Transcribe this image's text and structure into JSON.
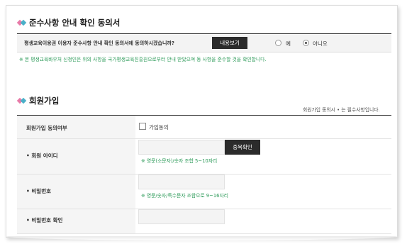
{
  "agreement": {
    "title": "준수사항 안내 확인 동의서",
    "question": "평생교육이용권 이용자 준수사항 안내 확인 동의서에 동의하시겠습니까?",
    "view_button": "내용보기",
    "option_yes": "예",
    "option_no": "아니오",
    "selected": "아니오",
    "note": "※ 본 평생교육바우처 신청인은 위의 사항을 국가평생교육진흥원으로부터 안내 받았으며 동 사항을 준수할 것을 확인합니다."
  },
  "signup": {
    "title": "회원가입",
    "required_note": "회원가입 동의시 • 는 필수사항입니다.",
    "rows": {
      "agree": {
        "label": "회원가입 동의여부",
        "checkbox_label": "가입동의"
      },
      "user_id": {
        "label": "• 회원 아이디",
        "value": "",
        "check_button": "중복확인",
        "hint": "※ 영문(소문자)/숫자 조합 5~10자리"
      },
      "password": {
        "label": "• 비밀번호",
        "value": "",
        "hint": "※ 영문/숫자/특수문자 조합으로 9~16자리"
      },
      "password_confirm": {
        "label": "• 비밀번호 확인",
        "value": ""
      }
    }
  },
  "colors": {
    "accent_pink": "#e87aa8",
    "accent_teal": "#4ab0c8",
    "hint_green": "#2e9b5a",
    "button_dark": "#2b2b2b"
  }
}
